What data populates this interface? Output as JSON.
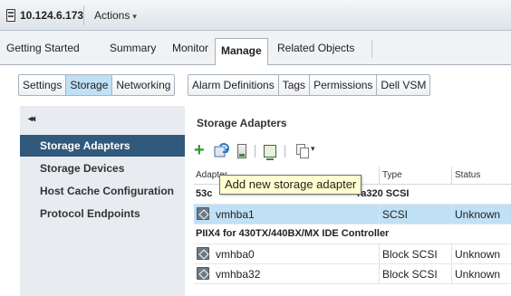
{
  "header": {
    "host_title": "10.124.6.173",
    "actions_label": "Actions",
    "host_icon": "host-server-icon"
  },
  "main_tabs": [
    {
      "label": "Getting Started"
    },
    {
      "label": "Summary"
    },
    {
      "label": "Monitor"
    },
    {
      "label": "Manage",
      "active": true
    },
    {
      "label": "Related Objects"
    }
  ],
  "sub_tabs": [
    {
      "label": "Settings"
    },
    {
      "label": "Storage",
      "active": true
    },
    {
      "label": "Networking"
    },
    {
      "label": "Alarm Definitions"
    },
    {
      "label": "Tags"
    },
    {
      "label": "Permissions"
    },
    {
      "label": "Dell VSM"
    }
  ],
  "sidebar": {
    "collapse_label": "◂◂",
    "items": [
      {
        "label": "Storage Adapters",
        "active": true
      },
      {
        "label": "Storage Devices"
      },
      {
        "label": "Host Cache Configuration"
      },
      {
        "label": "Protocol Endpoints"
      }
    ]
  },
  "content": {
    "title": "Storage Adapters",
    "toolbar": {
      "add_icon": "plus-icon",
      "rescan_icon": "rescan-storage-icon",
      "adapter_icon": "storage-adapter-icon",
      "monitor_icon": "rescan-vmfs-icon",
      "copy_icon": "copy-icon",
      "copy_caret": "▾"
    },
    "tooltip": "Add new storage adapter",
    "columns": [
      "Adapter",
      "Type",
      "Status"
    ],
    "groups": [
      {
        "name": "53c1030 PCI-X Fusion-MPT Dual Ultra320 SCSI",
        "visible_name_left": "53c",
        "visible_name_right": "ra320 SCSI",
        "rows": [
          {
            "adapter": "vmhba1",
            "type": "SCSI",
            "status": "Unknown",
            "selected": true
          }
        ]
      },
      {
        "name": "PIIX4 for 430TX/440BX/MX IDE Controller",
        "rows": [
          {
            "adapter": "vmhba0",
            "type": "Block SCSI",
            "status": "Unknown"
          },
          {
            "adapter": "vmhba32",
            "type": "Block SCSI",
            "status": "Unknown"
          }
        ]
      }
    ]
  },
  "colors": {
    "selected_row": "#bfe0f5",
    "nav_active": "#31597b",
    "add_green": "#2e9a2e",
    "tooltip_bg": "#ffffcf"
  }
}
